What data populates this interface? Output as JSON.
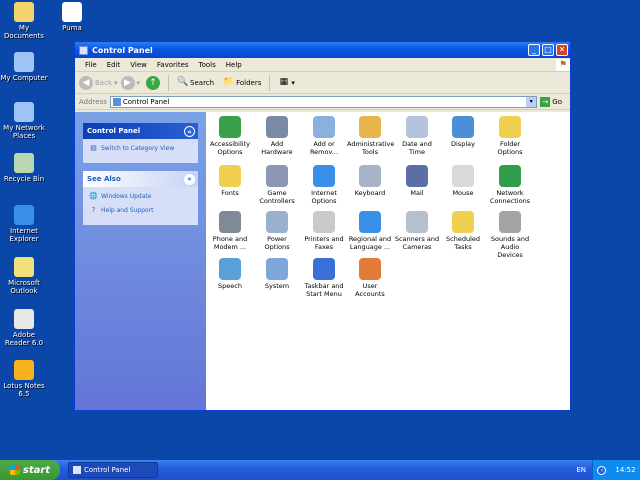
{
  "desktop": {
    "icons": [
      {
        "label": "My Documents",
        "icon": "folder-documents-icon",
        "color": "#f3d36a"
      },
      {
        "label": "Puma",
        "icon": "puma-app-icon",
        "color": "#ffffff"
      },
      {
        "label": "My Computer",
        "icon": "computer-icon",
        "color": "#9fc3f5"
      },
      {
        "label": "My Network Places",
        "icon": "network-places-icon",
        "color": "#9fc3f5"
      },
      {
        "label": "Recycle Bin",
        "icon": "recycle-bin-icon",
        "color": "#b9d7b0"
      },
      {
        "label": "Internet Explorer",
        "icon": "internet-explorer-icon",
        "color": "#3a8fe8"
      },
      {
        "label": "Microsoft Outlook",
        "icon": "outlook-icon",
        "color": "#f2e07a"
      },
      {
        "label": "Adobe Reader 6.0",
        "icon": "adobe-reader-icon",
        "color": "#e8e8e8"
      },
      {
        "label": "Lotus Notes 6.5",
        "icon": "lotus-notes-icon",
        "color": "#f6b21b"
      }
    ]
  },
  "window": {
    "title": "Control Panel",
    "menu": [
      "File",
      "Edit",
      "View",
      "Favorites",
      "Tools",
      "Help"
    ],
    "toolbar": {
      "back_label": "Back",
      "search_label": "Search",
      "folders_label": "Folders"
    },
    "address": {
      "label": "Address",
      "value": "Control Panel",
      "go_label": "Go"
    },
    "sidebar": {
      "control_panel_header": "Control Panel",
      "switch_link": "Switch to Category View",
      "see_also_header": "See Also",
      "see_also_links": [
        "Windows Update",
        "Help and Support"
      ]
    },
    "items": [
      {
        "label": "Accessibility Options",
        "icon": "accessibility-icon",
        "color": "#3aa04a"
      },
      {
        "label": "Add Hardware",
        "icon": "add-hardware-icon",
        "color": "#7b8aa3"
      },
      {
        "label": "Add or Remov...",
        "icon": "add-remove-programs-icon",
        "color": "#8ab0de"
      },
      {
        "label": "Administrative Tools",
        "icon": "administrative-tools-icon",
        "color": "#e8b54a"
      },
      {
        "label": "Date and Time",
        "icon": "date-time-icon",
        "color": "#b3c4dc"
      },
      {
        "label": "Display",
        "icon": "display-icon",
        "color": "#4a8fd8"
      },
      {
        "label": "Folder Options",
        "icon": "folder-options-icon",
        "color": "#f1cf4f"
      },
      {
        "label": "Fonts",
        "icon": "fonts-icon",
        "color": "#f1cf4f"
      },
      {
        "label": "Game Controllers",
        "icon": "game-controllers-icon",
        "color": "#8b97b3"
      },
      {
        "label": "Internet Options",
        "icon": "internet-options-icon",
        "color": "#3a8fe8"
      },
      {
        "label": "Keyboard",
        "icon": "keyboard-icon",
        "color": "#a7b4c8"
      },
      {
        "label": "Mail",
        "icon": "mail-icon",
        "color": "#5b6ea8"
      },
      {
        "label": "Mouse",
        "icon": "mouse-icon",
        "color": "#d9d9d9"
      },
      {
        "label": "Network Connections",
        "icon": "network-connections-icon",
        "color": "#2f9d4a"
      },
      {
        "label": "Phone and Modem ...",
        "icon": "phone-modem-icon",
        "color": "#7f8a96"
      },
      {
        "label": "Power Options",
        "icon": "power-options-icon",
        "color": "#9ab0cf"
      },
      {
        "label": "Printers and Faxes",
        "icon": "printers-faxes-icon",
        "color": "#c9c9c9"
      },
      {
        "label": "Regional and Language ...",
        "icon": "regional-language-icon",
        "color": "#3a8fe8"
      },
      {
        "label": "Scanners and Cameras",
        "icon": "scanners-cameras-icon",
        "color": "#b6c0cc"
      },
      {
        "label": "Scheduled Tasks",
        "icon": "scheduled-tasks-icon",
        "color": "#f1cf4f"
      },
      {
        "label": "Sounds and Audio Devices",
        "icon": "sounds-audio-icon",
        "color": "#a4a4a4"
      },
      {
        "label": "Speech",
        "icon": "speech-icon",
        "color": "#5aa0d8"
      },
      {
        "label": "System",
        "icon": "system-icon",
        "color": "#7fa6d8"
      },
      {
        "label": "Taskbar and Start Menu",
        "icon": "taskbar-start-menu-icon",
        "color": "#3a6fd8"
      },
      {
        "label": "User Accounts",
        "icon": "user-accounts-icon",
        "color": "#e47b3b"
      }
    ]
  },
  "taskbar": {
    "start_label": "start",
    "task_button": "Control Panel",
    "language": "EN",
    "clock": "14:52"
  }
}
